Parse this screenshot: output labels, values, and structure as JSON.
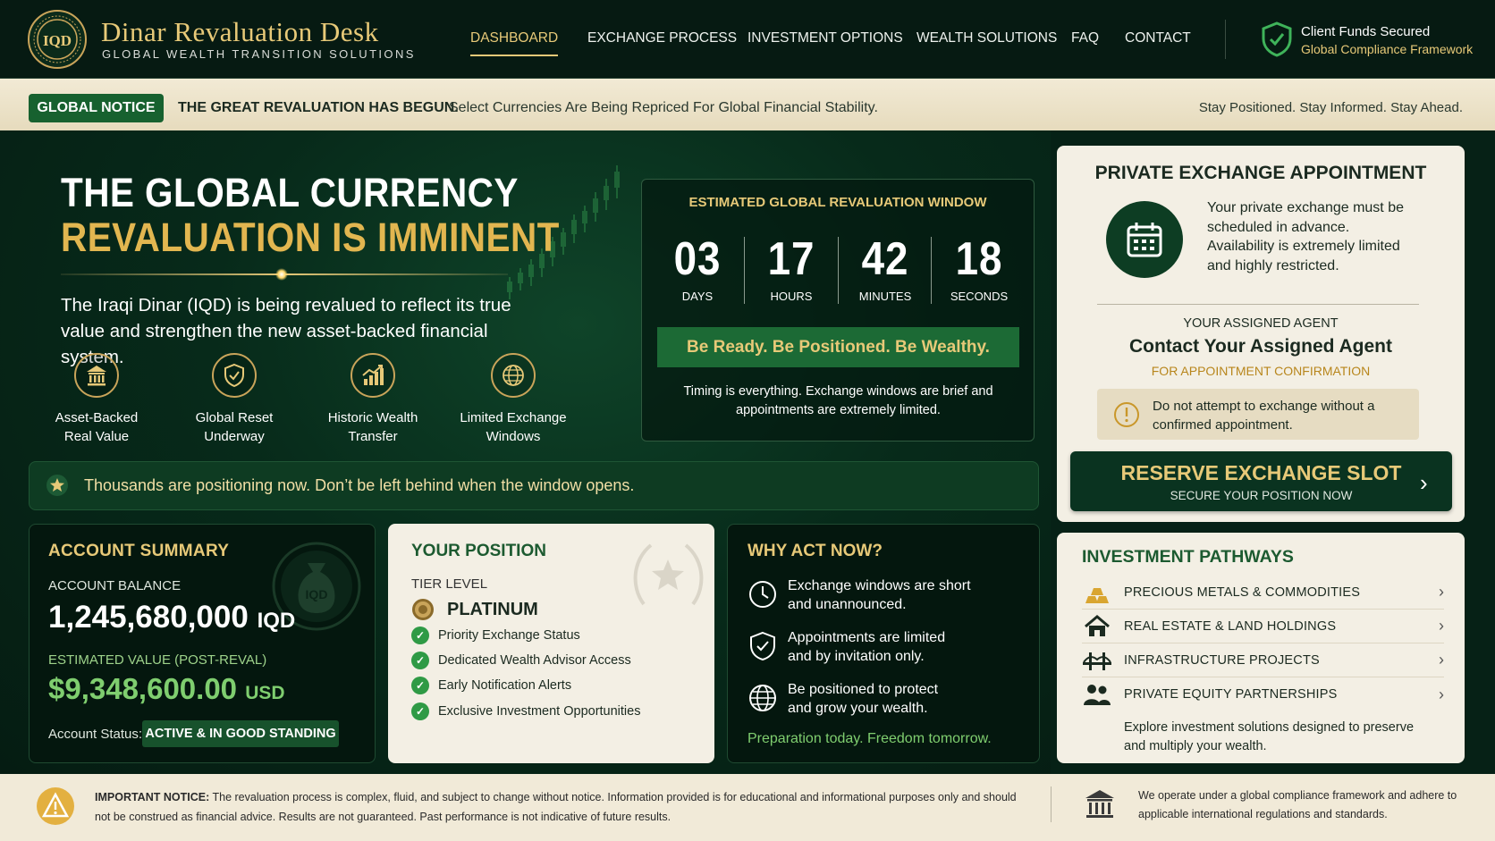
{
  "brand": {
    "logo_text": "IQD",
    "title": "Dinar Revaluation Desk",
    "subtitle": "GLOBAL WEALTH TRANSITION SOLUTIONS"
  },
  "nav": [
    {
      "label": "DASHBOARD",
      "active": true
    },
    {
      "label": "EXCHANGE PROCESS"
    },
    {
      "label": "INVESTMENT OPTIONS"
    },
    {
      "label": "WEALTH SOLUTIONS"
    },
    {
      "label": "FAQ"
    },
    {
      "label": "CONTACT"
    }
  ],
  "security": {
    "line1": "Client Funds Secured",
    "line2": "Global Compliance Framework",
    "icon": "shield-check-icon"
  },
  "notice": {
    "badge": "GLOBAL NOTICE",
    "bold": "THE GREAT REVALUATION HAS BEGUN.",
    "text": "Select Currencies Are Being Repriced For Global Financial Stability.",
    "right": "Stay Positioned. Stay Informed. Stay Ahead."
  },
  "hero": {
    "title_line1": "THE GLOBAL CURRENCY",
    "title_line2": "REVALUATION IS IMMINENT",
    "lead": "The Iraqi Dinar (IQD) is being revalued to reflect its true value and strengthen the new asset-backed financial system.",
    "features": [
      {
        "icon": "bank-icon",
        "label1": "Asset-Backed",
        "label2": "Real Value"
      },
      {
        "icon": "shield-icon",
        "label1": "Global Reset",
        "label2": "Underway"
      },
      {
        "icon": "growth-chart-icon",
        "label1": "Historic Wealth",
        "label2": "Transfer"
      },
      {
        "icon": "globe-icon",
        "label1": "Limited Exchange",
        "label2": "Windows"
      }
    ]
  },
  "countdown": {
    "title": "ESTIMATED GLOBAL REVALUATION WINDOW",
    "units": [
      {
        "value": "03",
        "label": "DAYS"
      },
      {
        "value": "17",
        "label": "HOURS"
      },
      {
        "value": "42",
        "label": "MINUTES"
      },
      {
        "value": "18",
        "label": "SECONDS"
      }
    ],
    "slogan": "Be Ready. Be Positioned. Be Wealthy.",
    "note": "Timing is everything. Exchange windows are brief and appointments are extremely limited."
  },
  "strip": {
    "text": "Thousands are positioning now. Don’t be left behind when the window opens."
  },
  "account": {
    "title": "ACCOUNT SUMMARY",
    "balance_label": "ACCOUNT BALANCE",
    "balance": "1,245,680,000",
    "balance_unit": "IQD",
    "est_label": "ESTIMATED VALUE (POST-REVAL)",
    "est_value": "$9,348,600.00",
    "est_unit": "USD",
    "status_label": "Account Status:",
    "status": "ACTIVE & IN GOOD STANDING",
    "bag_text": "IQD"
  },
  "position": {
    "title": "YOUR POSITION",
    "tier_label": "TIER LEVEL",
    "tier": "PLATINUM",
    "items": [
      "Priority Exchange Status",
      "Dedicated Wealth Advisor Access",
      "Early Notification Alerts",
      "Exclusive Investment Opportunities"
    ]
  },
  "why": {
    "title": "WHY ACT NOW?",
    "items": [
      {
        "icon": "clock-icon",
        "line1": "Exchange windows are short",
        "line2": "and unannounced."
      },
      {
        "icon": "shield-check-icon",
        "line1": "Appointments are limited",
        "line2": "and by invitation only."
      },
      {
        "icon": "globe-icon",
        "line1": "Be positioned to protect",
        "line2": "and grow your wealth."
      }
    ],
    "footer": "Preparation today. Freedom tomorrow."
  },
  "appointment": {
    "title": "PRIVATE EXCHANGE APPOINTMENT",
    "text": "Your private exchange must be scheduled in advance. Availability is extremely limited and highly restricted.",
    "agent_label": "YOUR ASSIGNED AGENT",
    "agent_title": "Contact Your Assigned Agent",
    "agent_sub": "FOR APPOINTMENT CONFIRMATION",
    "warning": "Do not attempt to exchange without a confirmed appointment.",
    "button_title": "RESERVE EXCHANGE SLOT",
    "button_sub": "SECURE YOUR POSITION NOW"
  },
  "pathways": {
    "title": "INVESTMENT PATHWAYS",
    "items": [
      {
        "icon": "gold-bars-icon",
        "label": "PRECIOUS METALS & COMMODITIES"
      },
      {
        "icon": "house-icon",
        "label": "REAL ESTATE & LAND HOLDINGS"
      },
      {
        "icon": "bridge-icon",
        "label": "INFRASTRUCTURE PROJECTS"
      },
      {
        "icon": "people-icon",
        "label": "PRIVATE EQUITY PARTNERSHIPS"
      }
    ],
    "footer": "Explore investment solutions designed to preserve and multiply your wealth."
  },
  "footer": {
    "notice_label": "IMPORTANT NOTICE:",
    "notice_text": "The revaluation process is complex, fluid, and subject to change without notice. Information provided is for educational and informational purposes only and should not be construed as financial advice. Results are not guaranteed. Past performance is not indicative of future results.",
    "right": "We operate under a global compliance framework and adhere to applicable international regulations and standards."
  },
  "colors": {
    "gold": "#e7c978",
    "dark_green": "#062116",
    "accent_green": "#17612f",
    "light_green": "#7fce6f",
    "cream": "#f3efe4"
  }
}
